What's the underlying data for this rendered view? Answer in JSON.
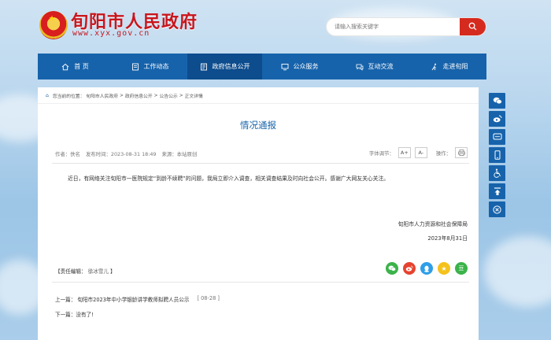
{
  "header": {
    "site_title": "旬阳市人民政府",
    "site_url": "www.xyx.gov.cn",
    "search_placeholder": "请输入搜索关键字"
  },
  "nav": {
    "items": [
      {
        "label": "首  页",
        "icon": "home-icon"
      },
      {
        "label": "工作动态",
        "icon": "news-icon"
      },
      {
        "label": "政府信息公开",
        "icon": "document-icon",
        "active": true
      },
      {
        "label": "公众服务",
        "icon": "monitor-icon"
      },
      {
        "label": "互动交流",
        "icon": "chat-icon"
      },
      {
        "label": "走进旬阳",
        "icon": "walk-icon"
      }
    ]
  },
  "breadcrumb": {
    "prefix": "您当前的位置：",
    "items": [
      "旬阳市人民政府",
      "政府信息公开",
      "公告公示",
      "正文详情"
    ]
  },
  "article": {
    "title": "情况通报",
    "author": "作者：佚名",
    "published": "发布时间：2023-08-31 18:49",
    "source": "来源：本站原创",
    "font_size_label": "字体调节：",
    "font_increase": "A+",
    "font_decrease": "A-",
    "action_label": "操作：",
    "body": "近日，有网络关注旬阳市一医院规定“到龄不续聘”的问题，我局立即介入调查，相关调查结果及时向社会公开。感谢广大网友关心关注。",
    "sign_org": "旬阳市人力资源和社会保障局",
    "sign_date": "2023年8月31日",
    "editor_label": "【责任编辑：",
    "editor_name": "徐冰雪儿",
    "editor_close": "】"
  },
  "share": {
    "items": [
      {
        "icon": "wechat-icon",
        "color": "#3bb34a"
      },
      {
        "icon": "weibo-icon",
        "color": "#e6432f"
      },
      {
        "icon": "qq-icon",
        "color": "#2f9ee8"
      },
      {
        "icon": "qzone-icon",
        "color": "#f4c21b"
      },
      {
        "icon": "douban-icon",
        "color": "#3bb34a",
        "label": "豆"
      }
    ]
  },
  "pager": {
    "prev_label": "上一篇：",
    "prev_title": "旬阳市2023年中小学银龄讲学教师拟聘人员公示",
    "prev_date": "[ 08-28 ]",
    "next_label": "下一篇：",
    "next_title": "没有了!"
  },
  "float_bar": {
    "items": [
      "wechat-icon",
      "weibo-icon",
      "app-icon",
      "mobile-icon",
      "accessibility-icon",
      "back-to-top-icon",
      "close-icon"
    ]
  },
  "colors": {
    "brand_blue": "#1763ab",
    "brand_red": "#c8161d"
  }
}
